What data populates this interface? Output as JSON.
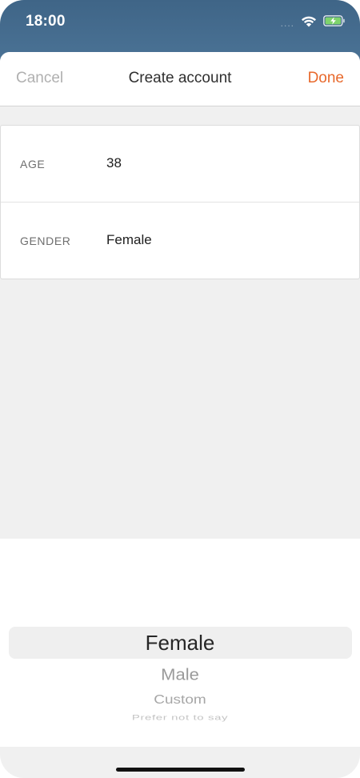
{
  "status_bar": {
    "time": "18:00",
    "signal": "....",
    "icons": [
      "cellular-dots-icon",
      "wifi-icon",
      "battery-charging-icon"
    ]
  },
  "nav": {
    "cancel_label": "Cancel",
    "title": "Create account",
    "done_label": "Done"
  },
  "form": {
    "rows": [
      {
        "label": "AGE",
        "value": "38"
      },
      {
        "label": "GENDER",
        "value": "Female"
      }
    ]
  },
  "picker": {
    "selected": "Female",
    "options": [
      "Female",
      "Male",
      "Custom",
      "Prefer not to say"
    ]
  },
  "colors": {
    "accent": "#e8692c",
    "status_bar": "#3f6587",
    "background": "#f0f0f0",
    "battery": "#7ed36c"
  }
}
